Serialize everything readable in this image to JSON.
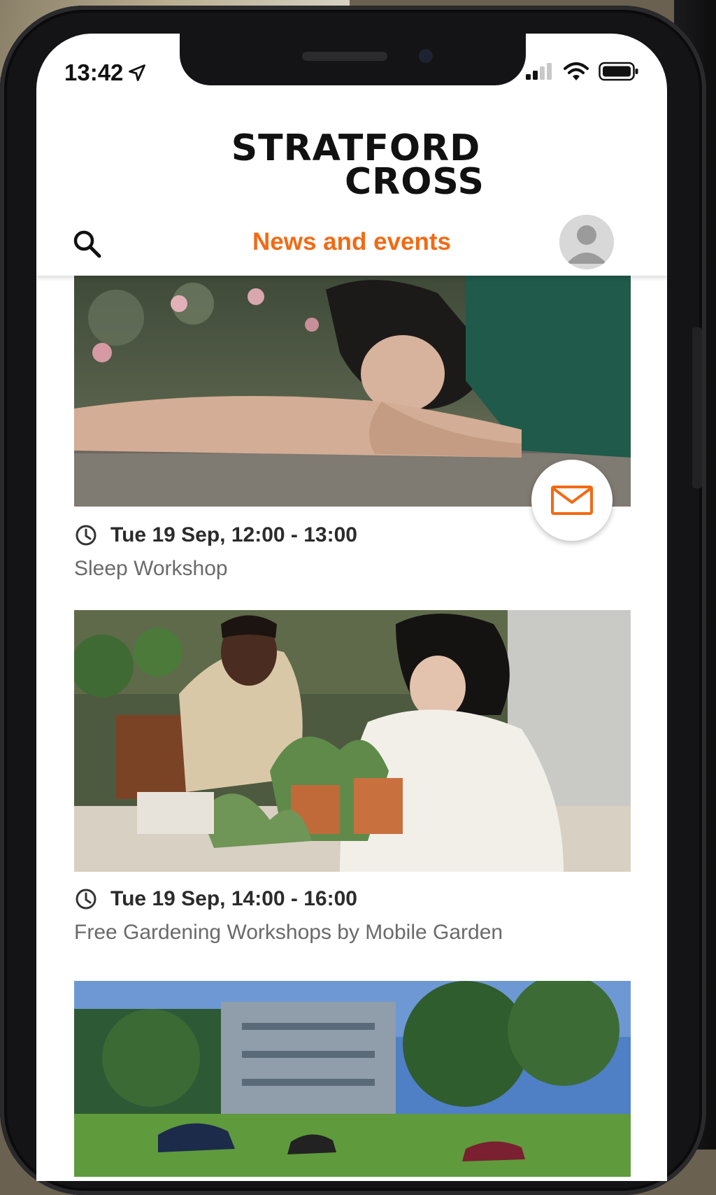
{
  "status_bar": {
    "time": "13:42"
  },
  "logo": {
    "line1": "STRATFORD",
    "line2": "CROSS"
  },
  "navbar": {
    "title": "News and events"
  },
  "events": [
    {
      "date": "Tue 19 Sep, 12:00 - 13:00",
      "title": "Sleep Workshop"
    },
    {
      "date": "Tue 19 Sep, 14:00 - 16:00",
      "title": "Free Gardening Workshops by Mobile Garden"
    }
  ],
  "colors": {
    "accent": "#f26a14",
    "text_dark": "#2b2b2b",
    "text_muted": "#6a6a6a"
  },
  "icons": [
    "location-arrow-icon",
    "signal-icon",
    "wifi-icon",
    "battery-icon",
    "search-icon",
    "avatar-icon",
    "mail-icon",
    "clock-icon"
  ]
}
